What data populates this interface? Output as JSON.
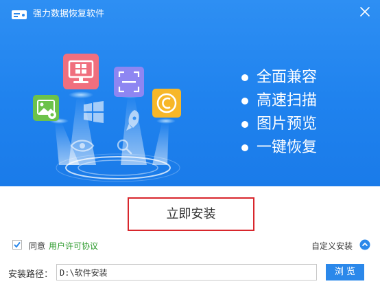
{
  "window": {
    "title": "强力数据恢复软件"
  },
  "icons": {
    "logo": "drive-logo-icon",
    "close": "close-icon",
    "monitor": "monitor-windows-icon",
    "scan": "scan-frame-icon",
    "image": "image-icon",
    "copyright": "copyright-icon",
    "windows": "windows-logo-icon",
    "rocket": "rocket-icon",
    "eye": "eye-icon",
    "search": "search-icon",
    "checkbox": "checkbox-checked-icon",
    "chevron": "chevron-up-circle-icon"
  },
  "colors": {
    "banner": "#1f82ee",
    "accent": "#2b88ea",
    "link": "#2b9a2b",
    "highlight_border": "#d8262c"
  },
  "features": [
    "全面兼容",
    "高速扫描",
    "图片预览",
    "一键恢复"
  ],
  "install": {
    "label": "立即安装"
  },
  "agreement": {
    "checked": true,
    "label": "同意",
    "link": "用户许可协议"
  },
  "custom_install": {
    "label": "自定义安装"
  },
  "path": {
    "label": "安装路径：",
    "value": "D:\\软件安装"
  },
  "browse": {
    "label": "浏 览"
  }
}
